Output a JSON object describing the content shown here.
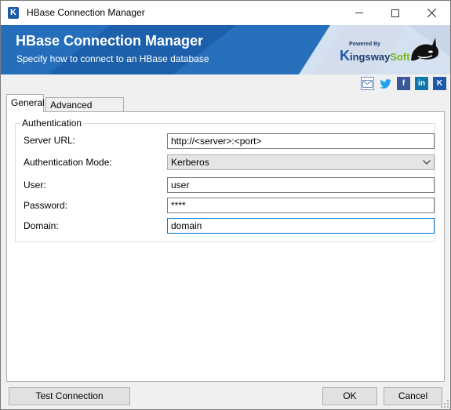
{
  "window": {
    "title": "HBase Connection Manager",
    "app_icon_letter": "K"
  },
  "banner": {
    "title": "HBase Connection Manager",
    "subtitle": "Specify how to connect to an HBase database",
    "logo_powered": "Powered By",
    "logo_name_k": "K",
    "logo_name_mid": "ingsway",
    "logo_name_end": "Soft"
  },
  "social": {
    "items": [
      "email-icon",
      "twitter-icon",
      "facebook-icon",
      "linkedin-icon",
      "kingswaysoft-icon"
    ],
    "fb_letter": "f",
    "in_letters": "in",
    "k_letter": "K"
  },
  "tabs": [
    {
      "label": "General",
      "active": true
    },
    {
      "label": "Advanced Settings",
      "active": false
    }
  ],
  "authentication": {
    "group_label": "Authentication",
    "server_url": {
      "label": "Server URL:",
      "value": "http://<server>:<port>"
    },
    "auth_mode": {
      "label": "Authentication Mode:",
      "value": "Kerberos"
    },
    "user": {
      "label": "User:",
      "value": "user"
    },
    "password": {
      "label": "Password:",
      "value": "****"
    },
    "domain": {
      "label": "Domain:",
      "value": "domain"
    }
  },
  "buttons": {
    "test_connection": "Test Connection",
    "ok": "OK",
    "cancel": "Cancel"
  },
  "colors": {
    "banner_blue": "#1f66b3",
    "focus_blue": "#0078d7"
  }
}
